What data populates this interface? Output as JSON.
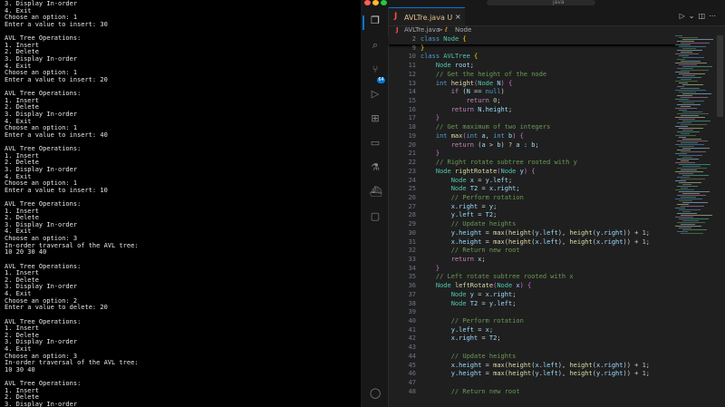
{
  "terminal": {
    "lines": [
      "3. Display In-order",
      "4. Exit",
      "Choose an option: 1",
      "Enter a value to insert: 30",
      "",
      "AVL Tree Operations:",
      "1. Insert",
      "2. Delete",
      "3. Display In-order",
      "4. Exit",
      "Choose an option: 1",
      "Enter a value to insert: 20",
      "",
      "AVL Tree Operations:",
      "1. Insert",
      "2. Delete",
      "3. Display In-order",
      "4. Exit",
      "Choose an option: 1",
      "Enter a value to insert: 40",
      "",
      "AVL Tree Operations:",
      "1. Insert",
      "2. Delete",
      "3. Display In-order",
      "4. Exit",
      "Choose an option: 1",
      "Enter a value to insert: 10",
      "",
      "AVL Tree Operations:",
      "1. Insert",
      "2. Delete",
      "3. Display In-order",
      "4. Exit",
      "Choose an option: 3",
      "In-order traversal of the AVL tree:",
      "10 20 30 40",
      "",
      "AVL Tree Operations:",
      "1. Insert",
      "2. Delete",
      "3. Display In-order",
      "4. Exit",
      "Choose an option: 2",
      "Enter a value to delete: 20",
      "",
      "AVL Tree Operations:",
      "1. Insert",
      "2. Delete",
      "3. Display In-order",
      "4. Exit",
      "Choose an option: 3",
      "In-order traversal of the AVL tree:",
      "10 30 40",
      "",
      "AVL Tree Operations:",
      "1. Insert",
      "2. Delete",
      "3. Display In-order"
    ]
  },
  "titlebar": {
    "search_text": "java"
  },
  "tab": {
    "name": "AVLTre.java U",
    "close": "×"
  },
  "breadcrumb": {
    "file": "AVLTre.java",
    "separator": ">",
    "symbol": "Node"
  },
  "activity": {
    "badge": "64"
  },
  "colors": {
    "accent": "#0078d4",
    "editor_bg": "#1f1f1f",
    "terminal_bg": "#000000"
  },
  "editor": {
    "lines": [
      {
        "n": "2",
        "t": [
          [
            "k1",
            "class "
          ],
          [
            "ty",
            "Node "
          ],
          [
            "br",
            "{"
          ]
        ],
        "sticky": true
      },
      {
        "n": "9",
        "t": [
          [
            "br",
            "}"
          ]
        ]
      },
      {
        "n": "10",
        "t": [
          [
            "k1",
            "class "
          ],
          [
            "ty",
            "AVLTree "
          ],
          [
            "br",
            "{"
          ]
        ]
      },
      {
        "n": "11",
        "t": [
          [
            "op",
            "    "
          ],
          [
            "ty",
            "Node "
          ],
          [
            "va",
            "root"
          ],
          [
            "op",
            ";"
          ]
        ]
      },
      {
        "n": "12",
        "t": [
          [
            "cm",
            "    // Get the height of the node"
          ]
        ]
      },
      {
        "n": "13",
        "t": [
          [
            "op",
            "    "
          ],
          [
            "k1",
            "int "
          ],
          [
            "fn",
            "height"
          ],
          [
            "br2",
            "("
          ],
          [
            "ty",
            "Node "
          ],
          [
            "va",
            "N"
          ],
          [
            "br2",
            ")"
          ],
          [
            "op",
            " "
          ],
          [
            "br2",
            "{"
          ]
        ]
      },
      {
        "n": "14",
        "t": [
          [
            "op",
            "        "
          ],
          [
            "k2",
            "if "
          ],
          [
            "op",
            "("
          ],
          [
            "va",
            "N"
          ],
          [
            "op",
            " == "
          ],
          [
            "k1",
            "null"
          ],
          [
            "op",
            ")"
          ]
        ]
      },
      {
        "n": "15",
        "t": [
          [
            "op",
            "            "
          ],
          [
            "k2",
            "return "
          ],
          [
            "nu",
            "0"
          ],
          [
            "op",
            ";"
          ]
        ]
      },
      {
        "n": "16",
        "t": [
          [
            "op",
            "        "
          ],
          [
            "k2",
            "return "
          ],
          [
            "va",
            "N"
          ],
          [
            "op",
            "."
          ],
          [
            "va",
            "height"
          ],
          [
            "op",
            ";"
          ]
        ]
      },
      {
        "n": "17",
        "t": [
          [
            "op",
            "    "
          ],
          [
            "br2",
            "}"
          ]
        ]
      },
      {
        "n": "18",
        "t": [
          [
            "cm",
            "    // Get maximum of two integers"
          ]
        ]
      },
      {
        "n": "19",
        "t": [
          [
            "op",
            "    "
          ],
          [
            "k1",
            "int "
          ],
          [
            "fn",
            "max"
          ],
          [
            "br2",
            "("
          ],
          [
            "k1",
            "int "
          ],
          [
            "va",
            "a"
          ],
          [
            "op",
            ", "
          ],
          [
            "k1",
            "int "
          ],
          [
            "va",
            "b"
          ],
          [
            "br2",
            ")"
          ],
          [
            "op",
            " "
          ],
          [
            "br2",
            "{"
          ]
        ]
      },
      {
        "n": "20",
        "t": [
          [
            "op",
            "        "
          ],
          [
            "k2",
            "return "
          ],
          [
            "op",
            "("
          ],
          [
            "va",
            "a"
          ],
          [
            "op",
            " > "
          ],
          [
            "va",
            "b"
          ],
          [
            "op",
            ") ? "
          ],
          [
            "va",
            "a"
          ],
          [
            "op",
            " : "
          ],
          [
            "va",
            "b"
          ],
          [
            "op",
            ";"
          ]
        ]
      },
      {
        "n": "21",
        "t": [
          [
            "op",
            "    "
          ],
          [
            "br2",
            "}"
          ]
        ]
      },
      {
        "n": "22",
        "t": [
          [
            "cm",
            "    // Right rotate subtree rooted with y"
          ]
        ]
      },
      {
        "n": "23",
        "t": [
          [
            "op",
            "    "
          ],
          [
            "ty",
            "Node "
          ],
          [
            "fn",
            "rightRotate"
          ],
          [
            "br2",
            "("
          ],
          [
            "ty",
            "Node "
          ],
          [
            "va",
            "y"
          ],
          [
            "br2",
            ")"
          ],
          [
            "op",
            " "
          ],
          [
            "br2",
            "{"
          ]
        ]
      },
      {
        "n": "24",
        "t": [
          [
            "op",
            "        "
          ],
          [
            "ty",
            "Node "
          ],
          [
            "va",
            "x"
          ],
          [
            "op",
            " = "
          ],
          [
            "va",
            "y"
          ],
          [
            "op",
            "."
          ],
          [
            "va",
            "left"
          ],
          [
            "op",
            ";"
          ]
        ]
      },
      {
        "n": "25",
        "t": [
          [
            "op",
            "        "
          ],
          [
            "ty",
            "Node "
          ],
          [
            "va",
            "T2"
          ],
          [
            "op",
            " = "
          ],
          [
            "va",
            "x"
          ],
          [
            "op",
            "."
          ],
          [
            "va",
            "right"
          ],
          [
            "op",
            ";"
          ]
        ]
      },
      {
        "n": "26",
        "t": [
          [
            "cm",
            "        // Perform rotation"
          ]
        ]
      },
      {
        "n": "27",
        "t": [
          [
            "op",
            "        "
          ],
          [
            "va",
            "x"
          ],
          [
            "op",
            "."
          ],
          [
            "va",
            "right"
          ],
          [
            "op",
            " = "
          ],
          [
            "va",
            "y"
          ],
          [
            "op",
            ";"
          ]
        ]
      },
      {
        "n": "28",
        "t": [
          [
            "op",
            "        "
          ],
          [
            "va",
            "y"
          ],
          [
            "op",
            "."
          ],
          [
            "va",
            "left"
          ],
          [
            "op",
            " = "
          ],
          [
            "va",
            "T2"
          ],
          [
            "op",
            ";"
          ]
        ]
      },
      {
        "n": "29",
        "t": [
          [
            "cm",
            "        // Update heights"
          ]
        ]
      },
      {
        "n": "30",
        "t": [
          [
            "op",
            "        "
          ],
          [
            "va",
            "y"
          ],
          [
            "op",
            "."
          ],
          [
            "va",
            "height"
          ],
          [
            "op",
            " = "
          ],
          [
            "fn",
            "max"
          ],
          [
            "op",
            "("
          ],
          [
            "fn",
            "height"
          ],
          [
            "op",
            "("
          ],
          [
            "va",
            "y"
          ],
          [
            "op",
            "."
          ],
          [
            "va",
            "left"
          ],
          [
            "op",
            "), "
          ],
          [
            "fn",
            "height"
          ],
          [
            "op",
            "("
          ],
          [
            "va",
            "y"
          ],
          [
            "op",
            "."
          ],
          [
            "va",
            "right"
          ],
          [
            "op",
            ")) + "
          ],
          [
            "nu",
            "1"
          ],
          [
            "op",
            ";"
          ]
        ]
      },
      {
        "n": "31",
        "t": [
          [
            "op",
            "        "
          ],
          [
            "va",
            "x"
          ],
          [
            "op",
            "."
          ],
          [
            "va",
            "height"
          ],
          [
            "op",
            " = "
          ],
          [
            "fn",
            "max"
          ],
          [
            "op",
            "("
          ],
          [
            "fn",
            "height"
          ],
          [
            "op",
            "("
          ],
          [
            "va",
            "x"
          ],
          [
            "op",
            "."
          ],
          [
            "va",
            "left"
          ],
          [
            "op",
            "), "
          ],
          [
            "fn",
            "height"
          ],
          [
            "op",
            "("
          ],
          [
            "va",
            "x"
          ],
          [
            "op",
            "."
          ],
          [
            "va",
            "right"
          ],
          [
            "op",
            ")) + "
          ],
          [
            "nu",
            "1"
          ],
          [
            "op",
            ";"
          ]
        ]
      },
      {
        "n": "32",
        "t": [
          [
            "cm",
            "        // Return new root"
          ]
        ]
      },
      {
        "n": "33",
        "t": [
          [
            "op",
            "        "
          ],
          [
            "k2",
            "return "
          ],
          [
            "va",
            "x"
          ],
          [
            "op",
            ";"
          ]
        ]
      },
      {
        "n": "34",
        "t": [
          [
            "op",
            "    "
          ],
          [
            "br2",
            "}"
          ]
        ]
      },
      {
        "n": "35",
        "t": [
          [
            "cm",
            "    // Left rotate subtree rooted with x"
          ]
        ]
      },
      {
        "n": "36",
        "t": [
          [
            "op",
            "    "
          ],
          [
            "ty",
            "Node "
          ],
          [
            "fn",
            "leftRotate"
          ],
          [
            "br2",
            "("
          ],
          [
            "ty",
            "Node "
          ],
          [
            "va",
            "x"
          ],
          [
            "br2",
            ")"
          ],
          [
            "op",
            " "
          ],
          [
            "br2",
            "{"
          ]
        ]
      },
      {
        "n": "37",
        "t": [
          [
            "op",
            "        "
          ],
          [
            "ty",
            "Node "
          ],
          [
            "va",
            "y"
          ],
          [
            "op",
            " = "
          ],
          [
            "va",
            "x"
          ],
          [
            "op",
            "."
          ],
          [
            "va",
            "right"
          ],
          [
            "op",
            ";"
          ]
        ]
      },
      {
        "n": "38",
        "t": [
          [
            "op",
            "        "
          ],
          [
            "ty",
            "Node "
          ],
          [
            "va",
            "T2"
          ],
          [
            "op",
            " = "
          ],
          [
            "va",
            "y"
          ],
          [
            "op",
            "."
          ],
          [
            "va",
            "left"
          ],
          [
            "op",
            ";"
          ]
        ]
      },
      {
        "n": "39",
        "t": []
      },
      {
        "n": "40",
        "t": [
          [
            "cm",
            "        // Perform rotation"
          ]
        ]
      },
      {
        "n": "41",
        "t": [
          [
            "op",
            "        "
          ],
          [
            "va",
            "y"
          ],
          [
            "op",
            "."
          ],
          [
            "va",
            "left"
          ],
          [
            "op",
            " = "
          ],
          [
            "va",
            "x"
          ],
          [
            "op",
            ";"
          ]
        ]
      },
      {
        "n": "42",
        "t": [
          [
            "op",
            "        "
          ],
          [
            "va",
            "x"
          ],
          [
            "op",
            "."
          ],
          [
            "va",
            "right"
          ],
          [
            "op",
            " = "
          ],
          [
            "va",
            "T2"
          ],
          [
            "op",
            ";"
          ]
        ]
      },
      {
        "n": "43",
        "t": []
      },
      {
        "n": "44",
        "t": [
          [
            "cm",
            "        // Update heights"
          ]
        ]
      },
      {
        "n": "45",
        "t": [
          [
            "op",
            "        "
          ],
          [
            "va",
            "x"
          ],
          [
            "op",
            "."
          ],
          [
            "va",
            "height"
          ],
          [
            "op",
            " = "
          ],
          [
            "fn",
            "max"
          ],
          [
            "op",
            "("
          ],
          [
            "fn",
            "height"
          ],
          [
            "op",
            "("
          ],
          [
            "va",
            "x"
          ],
          [
            "op",
            "."
          ],
          [
            "va",
            "left"
          ],
          [
            "op",
            "), "
          ],
          [
            "fn",
            "height"
          ],
          [
            "op",
            "("
          ],
          [
            "va",
            "x"
          ],
          [
            "op",
            "."
          ],
          [
            "va",
            "right"
          ],
          [
            "op",
            ")) + "
          ],
          [
            "nu",
            "1"
          ],
          [
            "op",
            ";"
          ]
        ]
      },
      {
        "n": "46",
        "t": [
          [
            "op",
            "        "
          ],
          [
            "va",
            "y"
          ],
          [
            "op",
            "."
          ],
          [
            "va",
            "height"
          ],
          [
            "op",
            " = "
          ],
          [
            "fn",
            "max"
          ],
          [
            "op",
            "("
          ],
          [
            "fn",
            "height"
          ],
          [
            "op",
            "("
          ],
          [
            "va",
            "y"
          ],
          [
            "op",
            "."
          ],
          [
            "va",
            "left"
          ],
          [
            "op",
            "), "
          ],
          [
            "fn",
            "height"
          ],
          [
            "op",
            "("
          ],
          [
            "va",
            "y"
          ],
          [
            "op",
            "."
          ],
          [
            "va",
            "right"
          ],
          [
            "op",
            ")) + "
          ],
          [
            "nu",
            "1"
          ],
          [
            "op",
            ";"
          ]
        ]
      },
      {
        "n": "47",
        "t": []
      },
      {
        "n": "48",
        "t": [
          [
            "cm",
            "        // Return new root"
          ]
        ]
      }
    ]
  }
}
